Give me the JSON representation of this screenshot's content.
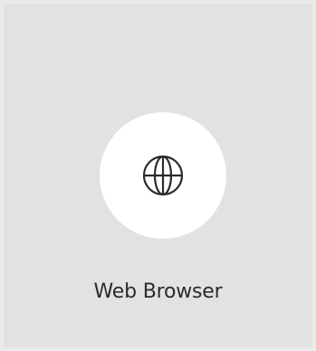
{
  "app": {
    "label": "Web Browser",
    "icon": "globe-icon"
  },
  "colors": {
    "background": "#e2e2e2",
    "icon_circle": "#ffffff",
    "icon_stroke": "#2b2b2b",
    "label_text": "#2b2b2b"
  }
}
